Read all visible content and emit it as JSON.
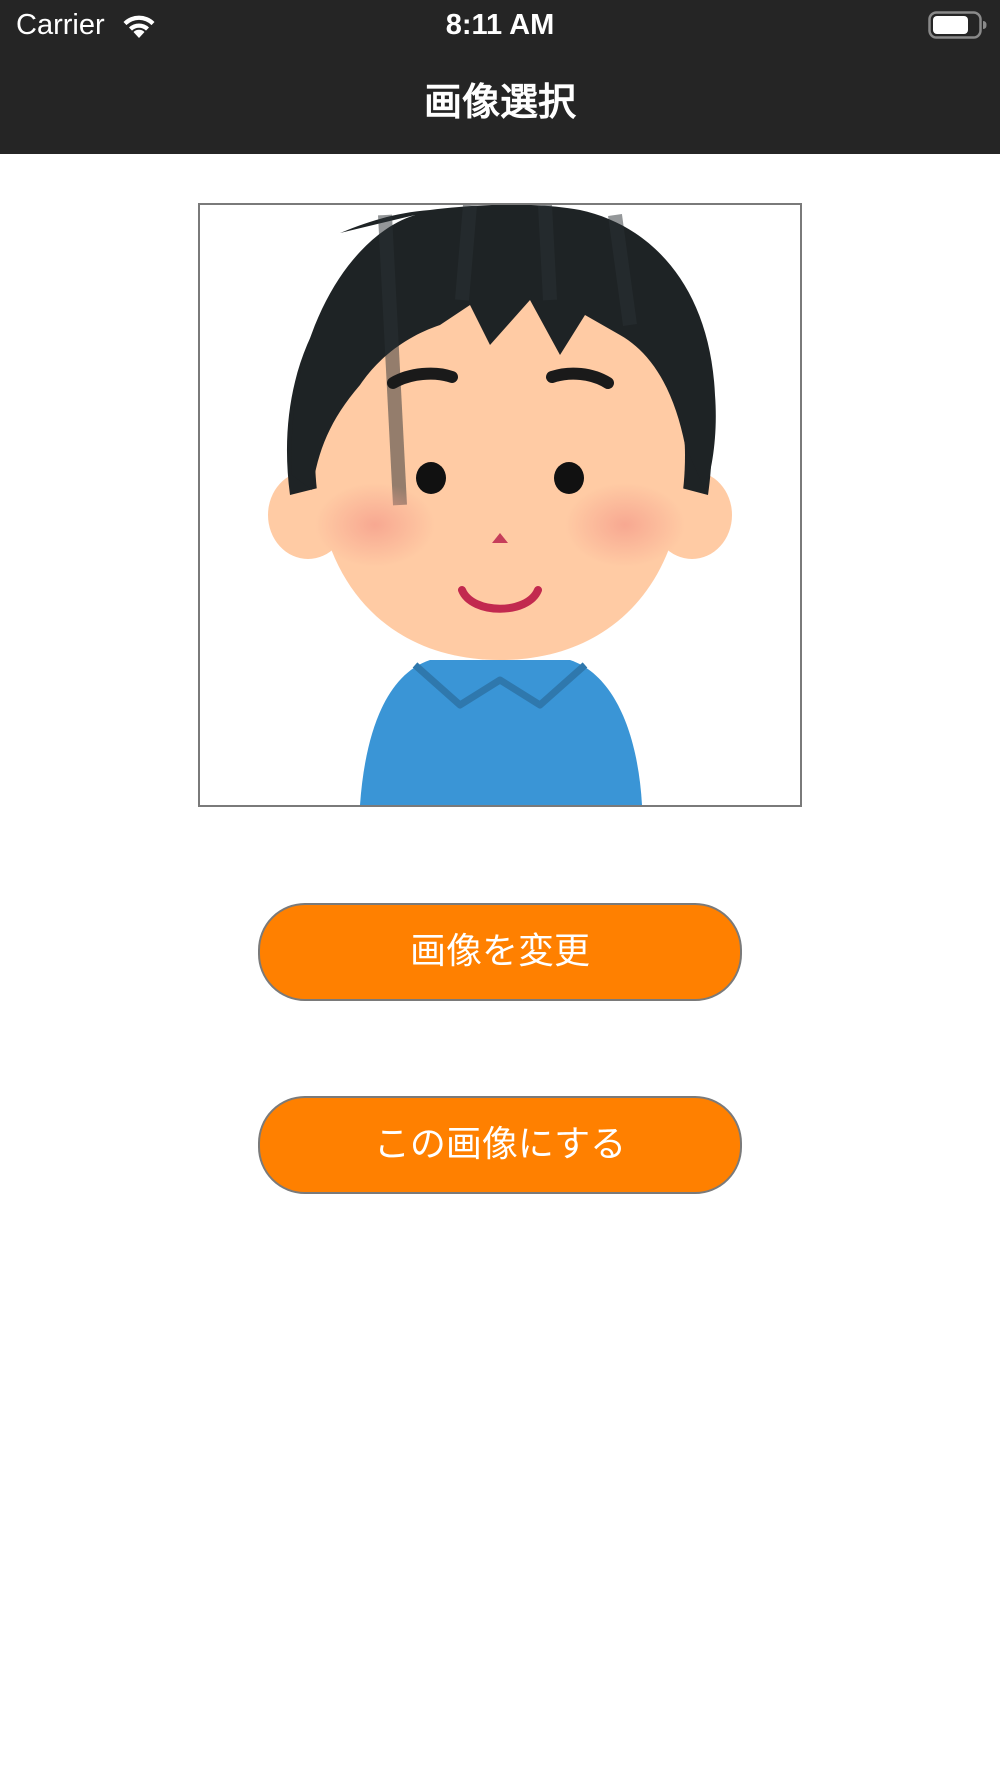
{
  "status_bar": {
    "carrier": "Carrier",
    "time": "8:11 AM",
    "wifi_icon": "wifi-icon",
    "battery_icon": "battery-icon"
  },
  "nav": {
    "title": "画像選択",
    "background_color": "#252525"
  },
  "image": {
    "icon": "boy-avatar-illustration",
    "border_color": "#7a7a7a"
  },
  "buttons": {
    "change_image": "画像を変更",
    "use_this_image": "この画像にする",
    "color": "#ff8000"
  }
}
